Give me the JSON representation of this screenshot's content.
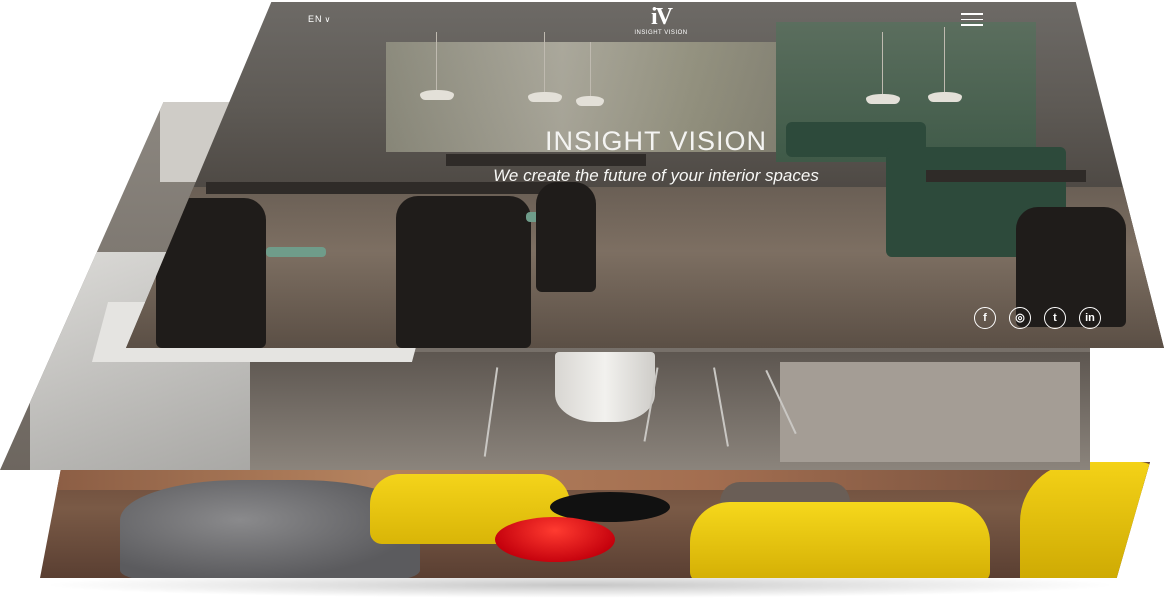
{
  "header": {
    "language": "EN",
    "logo_mark": "iV",
    "logo_name": "INSIGHT VISION"
  },
  "hero": {
    "title": "INSIGHT VISION",
    "subtitle": "We create the future of your interior spaces"
  },
  "socials": [
    {
      "name": "facebook",
      "glyph": "f"
    },
    {
      "name": "instagram",
      "glyph": "◎"
    },
    {
      "name": "twitter",
      "glyph": "t"
    },
    {
      "name": "linkedin",
      "glyph": "in"
    }
  ],
  "colors": {
    "text": "#ffffff",
    "accent_yellow": "#f4d41a",
    "accent_red": "#d9000f",
    "bench_green": "#2d4a3b"
  }
}
